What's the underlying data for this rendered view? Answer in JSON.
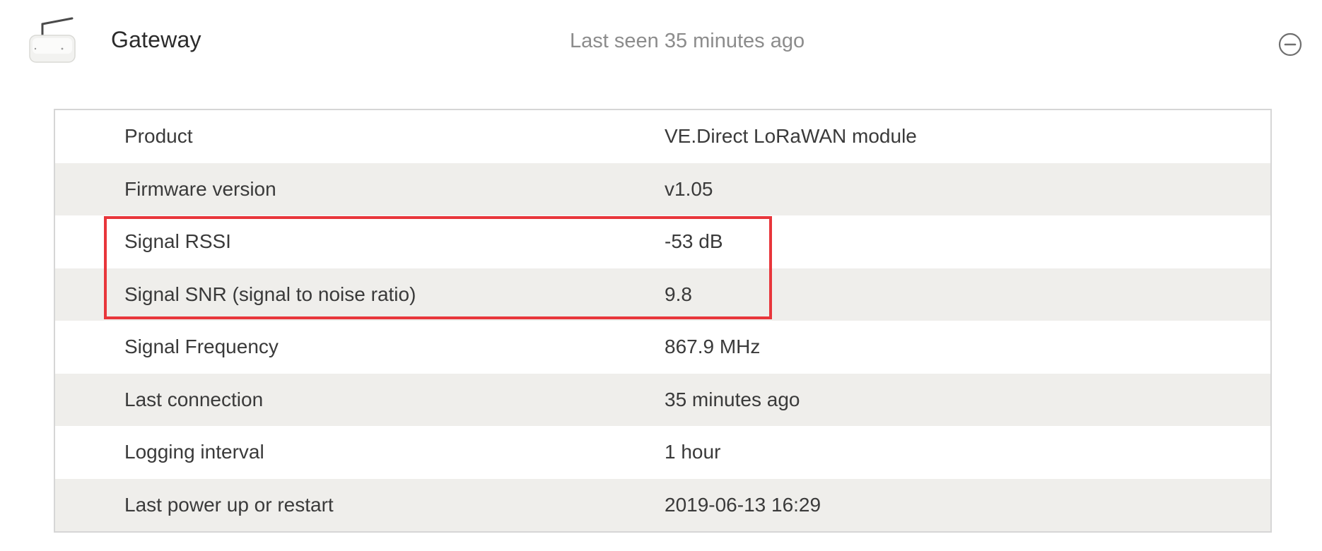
{
  "header": {
    "title": "Gateway",
    "last_seen": "Last seen 35 minutes ago",
    "device_icon": "lorawan-gateway-icon",
    "collapse_icon": "minus-circle-icon"
  },
  "details": {
    "rows": [
      {
        "label": "Product",
        "value": "VE.Direct LoRaWAN module"
      },
      {
        "label": "Firmware version",
        "value": "v1.05"
      },
      {
        "label": "Signal RSSI",
        "value": "-53 dB"
      },
      {
        "label": "Signal SNR (signal to noise ratio)",
        "value": "9.8"
      },
      {
        "label": "Signal Frequency",
        "value": "867.9 MHz"
      },
      {
        "label": "Last connection",
        "value": "35 minutes ago"
      },
      {
        "label": "Logging interval",
        "value": "1 hour"
      },
      {
        "label": "Last power up or restart",
        "value": "2019-06-13 16:29"
      }
    ]
  },
  "annotation": {
    "highlight_color": "#e8363b",
    "highlighted_rows": [
      "Signal RSSI",
      "Signal SNR (signal to noise ratio)"
    ]
  },
  "colors": {
    "row_alt_background": "#efeeeb",
    "border": "#d6d6d6",
    "muted_text": "#8c8c8c"
  }
}
